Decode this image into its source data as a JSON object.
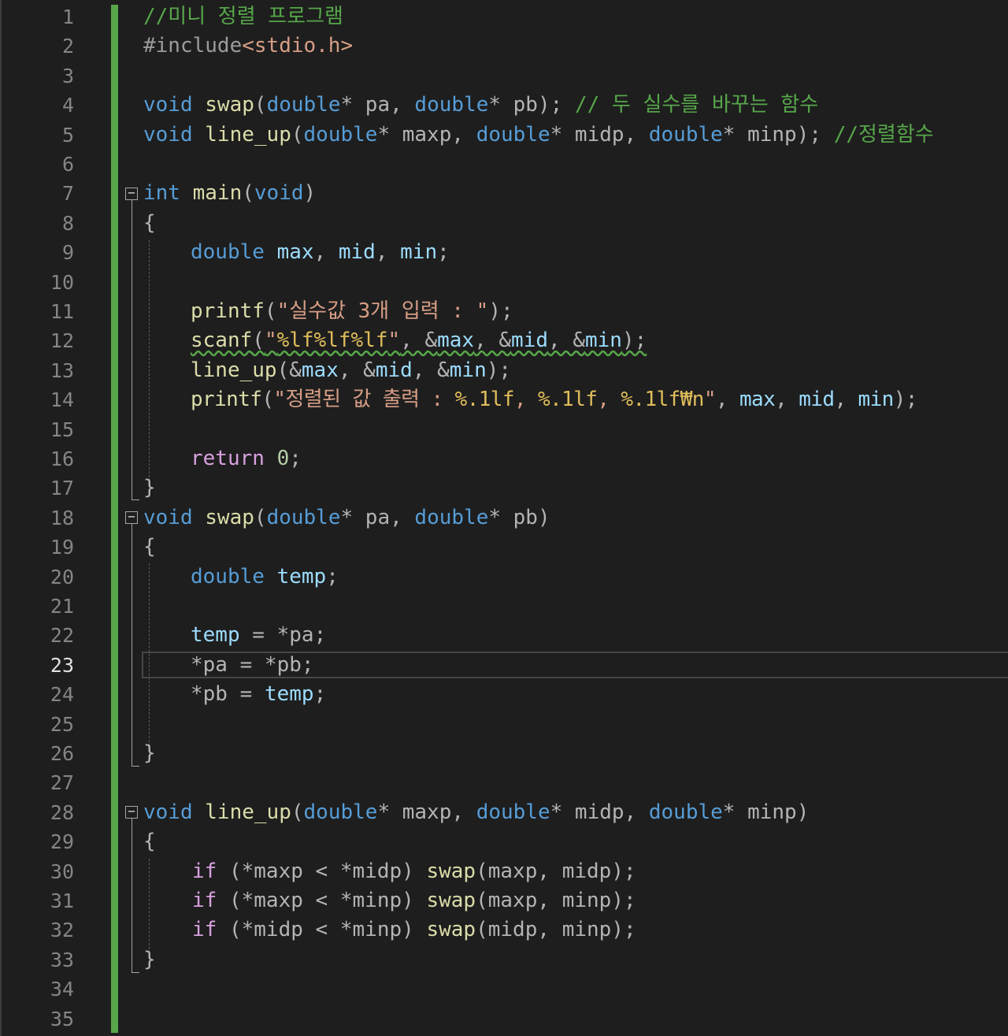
{
  "editor": {
    "active_line": 23,
    "line_numbers": [
      "1",
      "2",
      "3",
      "4",
      "5",
      "6",
      "7",
      "8",
      "9",
      "10",
      "11",
      "12",
      "13",
      "14",
      "15",
      "16",
      "17",
      "18",
      "19",
      "20",
      "21",
      "22",
      "23",
      "24",
      "25",
      "26",
      "27",
      "28",
      "29",
      "30",
      "31",
      "32",
      "33",
      "34",
      "35"
    ],
    "colors": {
      "background": "#1e1e1e",
      "change_bar": "#57a64a",
      "keyword": "#569cd6",
      "function": "#dcdcaa",
      "string": "#d69d85",
      "comment": "#57a64a"
    },
    "code": {
      "l1": {
        "comment": "//미니 정렬 프로그램"
      },
      "l2": {
        "directive": "#include",
        "header": "<stdio.h>"
      },
      "l4": {
        "kw_void": "void",
        "fn": "swap",
        "p1": "(",
        "t1": "double",
        "s1": "* ",
        "a1": "pa",
        "c1": ", ",
        "t2": "double",
        "s2": "* ",
        "a2": "pb",
        "end": "); ",
        "comment": "// 두 실수를 바꾸는 함수"
      },
      "l5": {
        "kw_void": "void",
        "fn": "line_up",
        "p1": "(",
        "t1": "double",
        "s1": "* ",
        "a1": "maxp",
        "c1": ", ",
        "t2": "double",
        "s2": "* ",
        "a2": "midp",
        "c2": ", ",
        "t3": "double",
        "s3": "* ",
        "a3": "minp",
        "end": "); ",
        "comment": "//정렬함수"
      },
      "l7": {
        "kw_int": "int",
        "fn": "main",
        "p1": "(",
        "kw_void": "void",
        "p2": ")"
      },
      "l8": {
        "brace": "{"
      },
      "l9": {
        "type": "double",
        "v1": "max",
        "c1": ", ",
        "v2": "mid",
        "c2": ", ",
        "v3": "min",
        "end": ";"
      },
      "l11": {
        "fn": "printf",
        "p1": "(",
        "str": "\"실수값 3개 입력 : \"",
        "end": ");"
      },
      "l12": {
        "fn": "scanf",
        "p1": "(",
        "s1": "\"",
        "f1": "%lf%lf%lf",
        "s2": "\"",
        "a1": ", &",
        "v1": "max",
        "a2": ", &",
        "v2": "mid",
        "a3": ", &",
        "v3": "min",
        "end": ");"
      },
      "l13": {
        "fn": "line_up",
        "p1": "(&",
        "v1": "max",
        "a1": ", &",
        "v2": "mid",
        "a2": ", &",
        "v3": "min",
        "end": ");"
      },
      "l14": {
        "fn": "printf",
        "p1": "(",
        "s1": "\"정렬된 값 출력 : ",
        "f1": "%.1lf",
        "s2": ", ",
        "f2": "%.1lf",
        "s3": ", ",
        "f3": "%.1lf",
        "esc": "₩n",
        "s4": "\"",
        "c0": ", ",
        "v1": "max",
        "c1": ", ",
        "v2": "mid",
        "c2": ", ",
        "v3": "min",
        "end": ");"
      },
      "l16": {
        "kw_return": "return",
        "sp": " ",
        "num": "0",
        "end": ";"
      },
      "l17": {
        "brace": "}"
      },
      "l18": {
        "kw_void": "void",
        "fn": "swap",
        "p1": "(",
        "t1": "double",
        "s1": "* ",
        "a1": "pa",
        "c1": ", ",
        "t2": "double",
        "s2": "* ",
        "a2": "pb",
        "end": ")"
      },
      "l19": {
        "brace": "{"
      },
      "l20": {
        "type": "double",
        "sp": " ",
        "v1": "temp",
        "end": ";"
      },
      "l22": {
        "v1": "temp",
        "op": " = *",
        "a1": "pa",
        "end": ";"
      },
      "l23": {
        "op1": "*",
        "a1": "pa",
        "op2": " = *",
        "a2": "pb",
        "end": ";"
      },
      "l24": {
        "op1": "*",
        "a1": "pb",
        "op2": " = ",
        "v1": "temp",
        "end": ";"
      },
      "l26": {
        "brace": "}"
      },
      "l28": {
        "kw_void": "void",
        "fn": "line_up",
        "p1": "(",
        "t1": "double",
        "s1": "* ",
        "a1": "maxp",
        "c1": ", ",
        "t2": "double",
        "s2": "* ",
        "a2": "midp",
        "c2": ", ",
        "t3": "double",
        "s3": "* ",
        "a3": "minp",
        "end": ")"
      },
      "l29": {
        "brace": "{"
      },
      "l30": {
        "kw_if": "if",
        "o1": " (*",
        "a1": "maxp",
        "o2": " < *",
        "a2": "midp",
        "o3": ") ",
        "fn": "swap",
        "o4": "(",
        "a3": "maxp",
        "o5": ", ",
        "a4": "midp",
        "end": ");"
      },
      "l31": {
        "kw_if": "if",
        "o1": " (*",
        "a1": "maxp",
        "o2": " < *",
        "a2": "minp",
        "o3": ") ",
        "fn": "swap",
        "o4": "(",
        "a3": "maxp",
        "o5": ", ",
        "a4": "minp",
        "end": ");"
      },
      "l32": {
        "kw_if": "if",
        "o1": " (*",
        "a1": "midp",
        "o2": " < *",
        "a2": "minp",
        "o3": ") ",
        "fn": "swap",
        "o4": "(",
        "a3": "midp",
        "o5": ", ",
        "a4": "minp",
        "end": ");"
      },
      "l33": {
        "brace": "}"
      }
    }
  }
}
